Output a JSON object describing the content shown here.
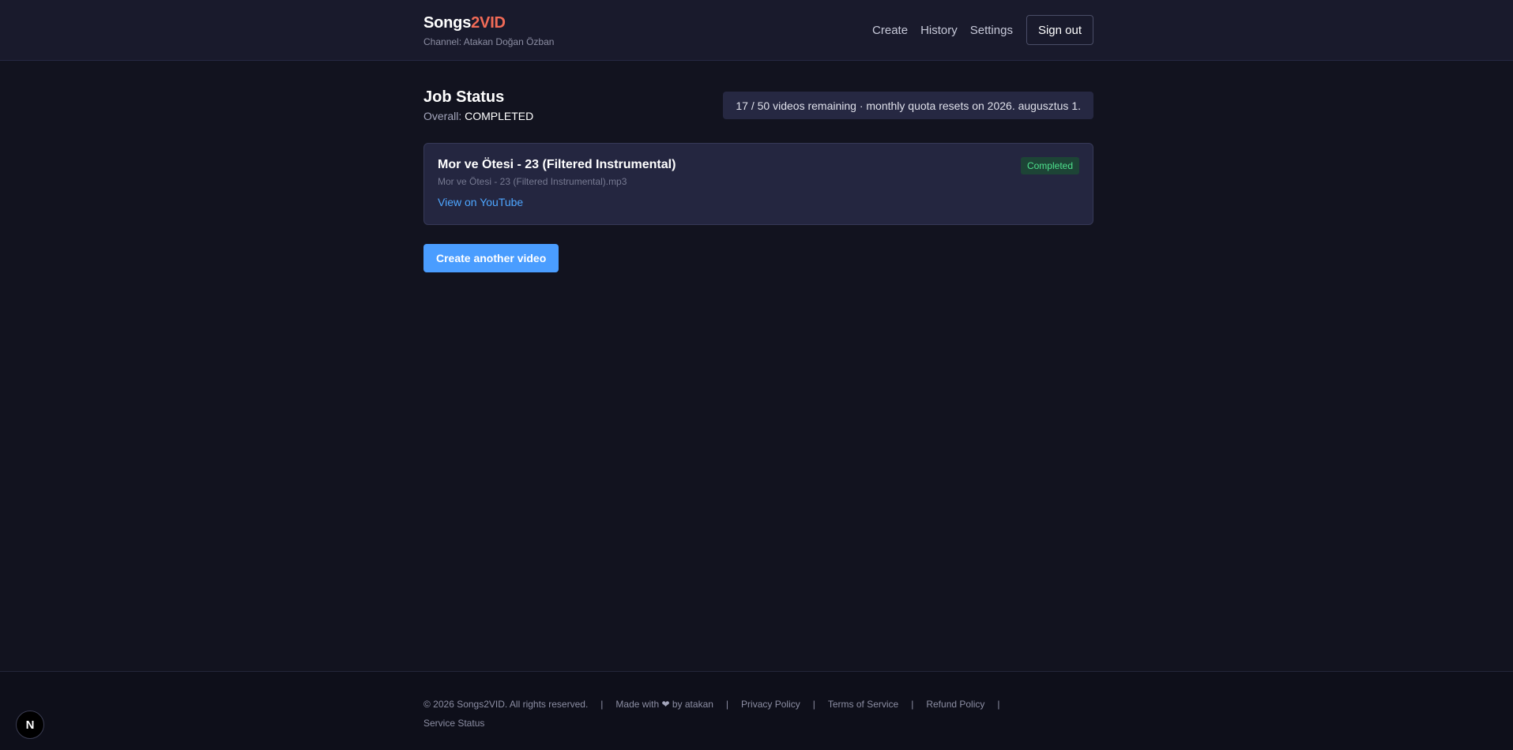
{
  "header": {
    "brand_part1": "Songs",
    "brand_part2": "2VID",
    "channel": "Channel: Atakan Doğan Özban",
    "nav": {
      "create": "Create",
      "history": "History",
      "settings": "Settings",
      "sign_out": "Sign out"
    }
  },
  "main": {
    "title": "Job Status",
    "overall_label": "Overall:",
    "overall_value": "COMPLETED",
    "quota_text": "17 / 50 videos remaining · monthly quota resets on 2026. augusztus 1.",
    "job": {
      "title": "Mor ve Ötesi - 23 (Filtered Instrumental)",
      "file": "Mor ve Ötesi - 23 (Filtered Instrumental).mp3",
      "link": "View on YouTube",
      "status": "Completed"
    },
    "create_another": "Create another video"
  },
  "footer": {
    "copyright": "© 2026 Songs2VID. All rights reserved.",
    "made_with_prefix": "Made with",
    "made_with_icon": "heart-icon",
    "made_with_suffix": "by atakan",
    "privacy": "Privacy Policy",
    "terms": "Terms of Service",
    "refund": "Refund Policy",
    "status": "Service Status",
    "separator": "|"
  },
  "dev_badge": {
    "icon": "nextjs-icon",
    "letter": "N"
  },
  "colors": {
    "background": "#12131f",
    "header": "#191a2c",
    "brand_accent": "#f26b57",
    "link": "#4ea6ff",
    "primary_button": "#4a9dff",
    "success_badge_bg": "#1d4436",
    "success_badge_text": "#4ee08d"
  }
}
